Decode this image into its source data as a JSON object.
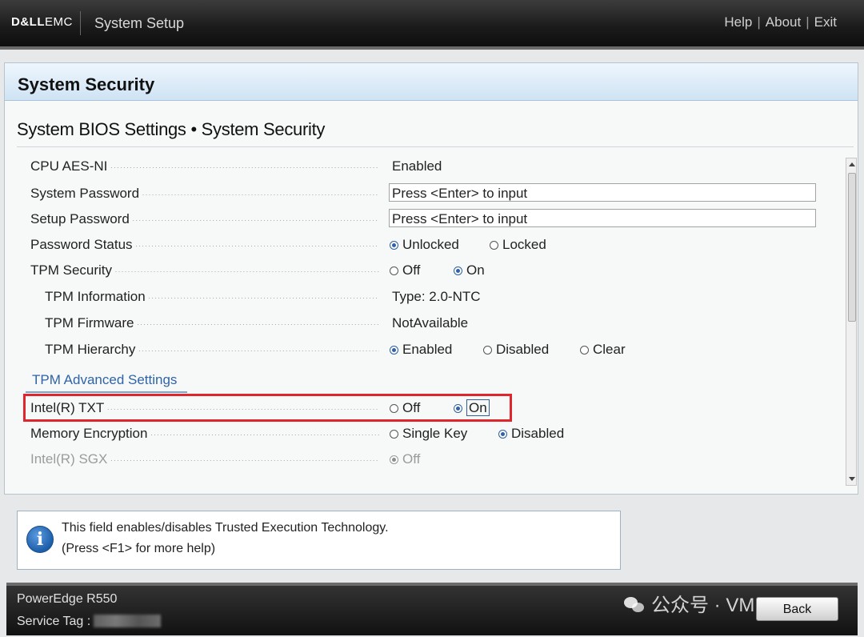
{
  "header": {
    "brand_bold": "D&LL",
    "brand_light": "EMC",
    "app_title": "System Setup",
    "links": [
      "Help",
      "About",
      "Exit"
    ]
  },
  "section": {
    "title": "System Security",
    "subtitle": "System BIOS Settings • System Security"
  },
  "settings": {
    "cpu_aes": {
      "label": "CPU AES-NI",
      "value": "Enabled"
    },
    "system_password": {
      "label": "System Password",
      "value": "Press <Enter> to input"
    },
    "setup_password": {
      "label": "Setup Password",
      "value": "Press <Enter> to input"
    },
    "password_status": {
      "label": "Password Status",
      "options": [
        "Unlocked",
        "Locked"
      ],
      "selected": "Unlocked"
    },
    "tpm_security": {
      "label": "TPM Security",
      "options": [
        "Off",
        "On"
      ],
      "selected": "On"
    },
    "tpm_information": {
      "label": "TPM Information",
      "value": "Type: 2.0-NTC"
    },
    "tpm_firmware": {
      "label": "TPM Firmware",
      "value": "NotAvailable"
    },
    "tpm_hierarchy": {
      "label": "TPM Hierarchy",
      "options": [
        "Enabled",
        "Disabled",
        "Clear"
      ],
      "selected": "Enabled"
    },
    "tpm_advanced_link": "TPM Advanced Settings",
    "intel_txt": {
      "label": "Intel(R) TXT",
      "options": [
        "Off",
        "On"
      ],
      "selected": "On"
    },
    "memory_encryption": {
      "label": "Memory Encryption",
      "options": [
        "Single Key",
        "Disabled"
      ],
      "selected": "Disabled"
    },
    "intel_sgx": {
      "label": "Intel(R) SGX",
      "options": [
        "Off"
      ],
      "selected": "Off"
    }
  },
  "help": {
    "line1": "This field enables/disables Trusted Execution Technology.",
    "line2": "(Press <F1> for more help)"
  },
  "footer": {
    "model": "PowerEdge R550",
    "service_tag_label": "Service Tag :",
    "back_label": "Back"
  },
  "watermark": "公众号 · VM"
}
